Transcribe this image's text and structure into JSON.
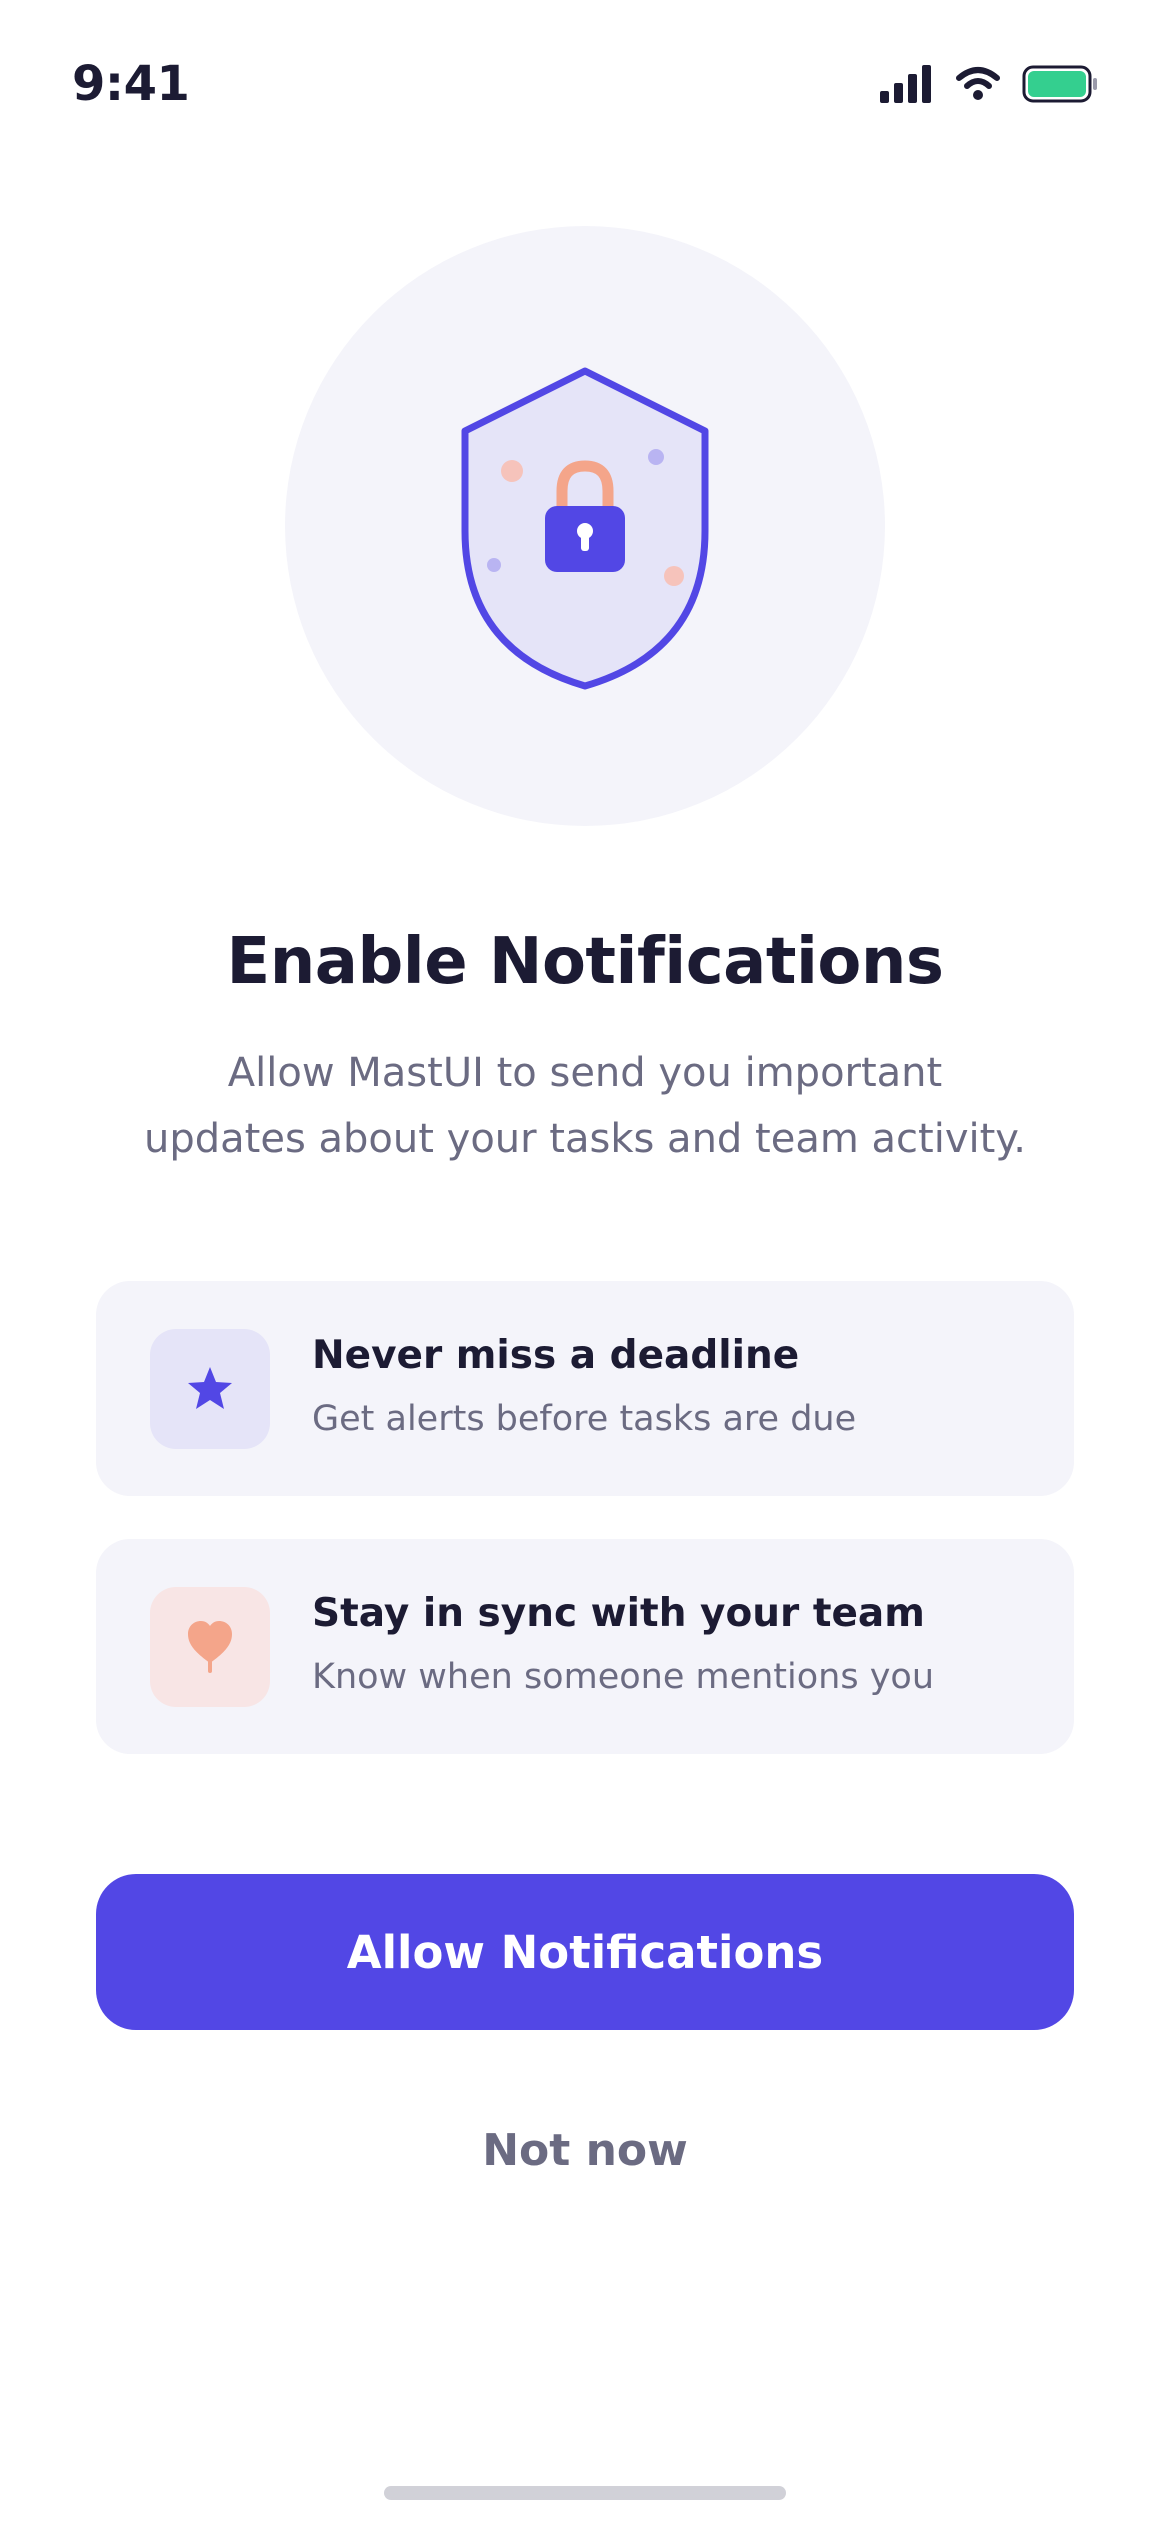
{
  "status_bar": {
    "time": "9:41",
    "icons": [
      "cellular-signal-icon",
      "wifi-icon",
      "battery-icon"
    ],
    "battery_color": "#34cf8f"
  },
  "hero": {
    "icon": "shield-lock-icon",
    "colors": {
      "circle": "#f4f4fa",
      "shield_fill": "#e5e4f8",
      "shield_stroke": "#5247e5",
      "lock_body": "#5247e5",
      "lock_shackle": "#f4a58a"
    }
  },
  "title": "Enable Notifications",
  "subtitle_lines": [
    "Allow MastUI to send you important",
    "updates about your tasks and team activity."
  ],
  "features": [
    {
      "icon": "star-icon",
      "icon_color": "#5247e5",
      "title": "Never miss a deadline",
      "description": "Get alerts before tasks are due"
    },
    {
      "icon": "heart-icon",
      "icon_color": "#f4a58a",
      "title": "Stay in sync with your team",
      "description": "Know when someone mentions you"
    }
  ],
  "actions": {
    "primary_label": "Allow Notifications",
    "secondary_label": "Not now"
  },
  "colors": {
    "accent": "#5247e5",
    "text_primary": "#1c1b33",
    "text_secondary": "#6b6b82",
    "card_background": "#f4f4fa"
  }
}
